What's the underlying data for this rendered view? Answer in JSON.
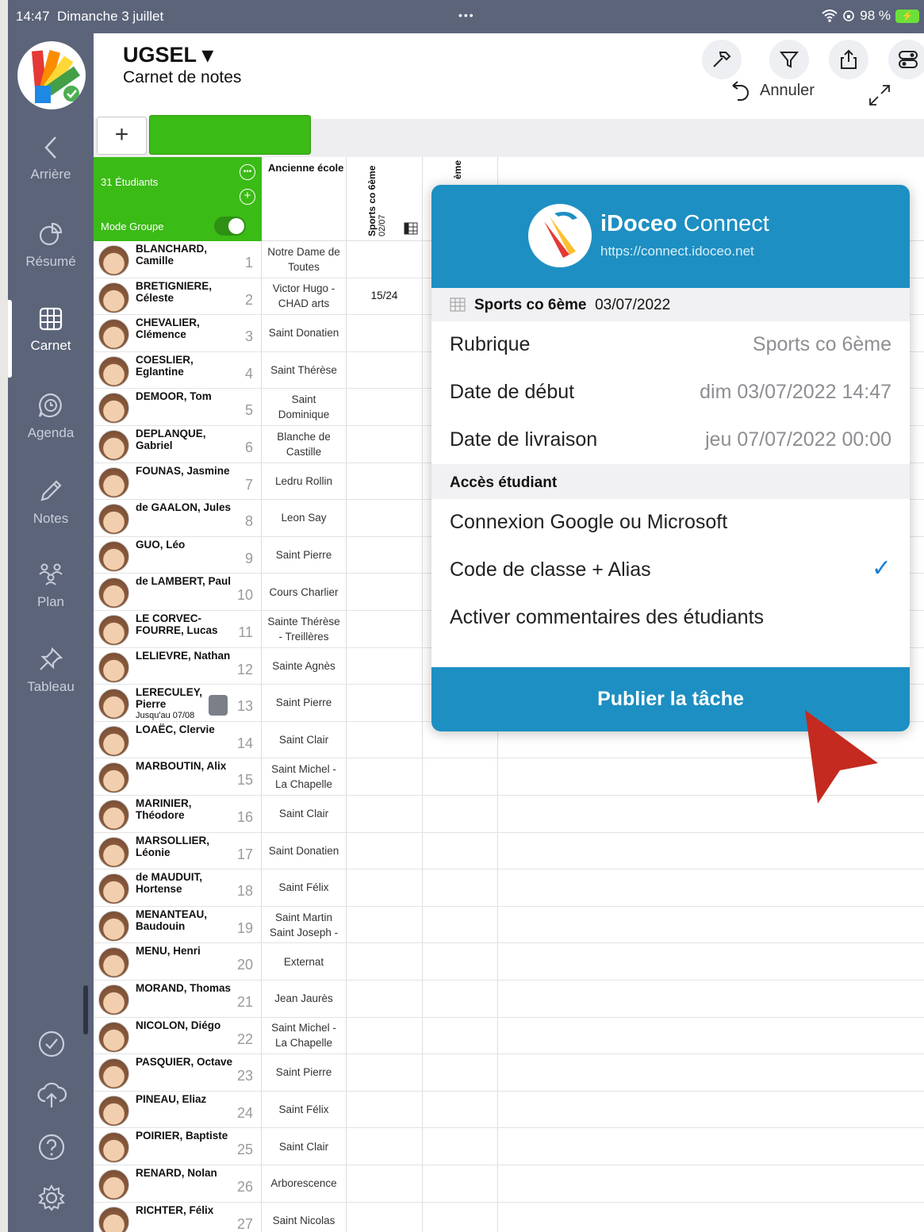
{
  "status": {
    "time": "14:47",
    "date": "Dimanche 3 juillet",
    "dots": "•••",
    "battery": "98 %"
  },
  "sidebar": {
    "items": [
      {
        "label": "Arrière"
      },
      {
        "label": "Résumé"
      },
      {
        "label": "Carnet"
      },
      {
        "label": "Agenda"
      },
      {
        "label": "Notes"
      },
      {
        "label": "Plan"
      },
      {
        "label": "Tableau"
      }
    ]
  },
  "header": {
    "title": "UGSEL ▾",
    "subtitle": "Carnet de notes",
    "undo_label": "Annuler"
  },
  "tabs": {
    "add_label": "+"
  },
  "group": {
    "count": "31 Étudiants",
    "mode": "Mode Groupe"
  },
  "columns": {
    "school": "Ancienne école",
    "task": "Sports co 6ème",
    "task_date": "02/07",
    "task2": "ème"
  },
  "students": [
    {
      "name": "BLANCHARD, Camille",
      "num": "1",
      "school": "Notre Dame de Toutes",
      "grade": ""
    },
    {
      "name": "BRETIGNIERE, Céleste",
      "num": "2",
      "school": "Victor Hugo - CHAD arts",
      "grade": "15/24"
    },
    {
      "name": "CHEVALIER, Clémence",
      "num": "3",
      "school": "Saint Donatien",
      "grade": ""
    },
    {
      "name": "COESLIER, Eglantine",
      "num": "4",
      "school": "Saint Thérèse",
      "grade": ""
    },
    {
      "name": "DEMOOR, Tom",
      "num": "5",
      "school": "Saint Dominique",
      "grade": ""
    },
    {
      "name": "DEPLANQUE, Gabriel",
      "num": "6",
      "school": "Blanche de Castille",
      "grade": ""
    },
    {
      "name": "FOUNAS, Jasmine",
      "num": "7",
      "school": "Ledru Rollin",
      "grade": ""
    },
    {
      "name": "de GAALON, Jules",
      "num": "8",
      "school": "Leon Say",
      "grade": ""
    },
    {
      "name": "GUO, Léo",
      "num": "9",
      "school": "Saint Pierre",
      "grade": ""
    },
    {
      "name": "de LAMBERT, Paul",
      "num": "10",
      "school": "Cours Charlier",
      "grade": ""
    },
    {
      "name": "LE CORVEC-FOURRE, Lucas",
      "num": "11",
      "school": "Sainte Thérèse - Treillères",
      "grade": ""
    },
    {
      "name": "LELIEVRE, Nathan",
      "num": "12",
      "school": "Sainte Agnès",
      "grade": ""
    },
    {
      "name": "LERECULEY, Pierre",
      "num": "13",
      "school": "Saint Pierre",
      "grade": "",
      "note": "Jusqu'au 07/08"
    },
    {
      "name": "LOAËC, Clervie",
      "num": "14",
      "school": "Saint Clair",
      "grade": ""
    },
    {
      "name": "MARBOUTIN, Alix",
      "num": "15",
      "school": "Saint Michel - La Chapelle",
      "grade": ""
    },
    {
      "name": "MARINIER, Théodore",
      "num": "16",
      "school": "Saint Clair",
      "grade": ""
    },
    {
      "name": "MARSOLLIER, Léonie",
      "num": "17",
      "school": "Saint Donatien",
      "grade": ""
    },
    {
      "name": "de MAUDUIT, Hortense",
      "num": "18",
      "school": "Saint Félix",
      "grade": ""
    },
    {
      "name": "MENANTEAU, Baudouin",
      "num": "19",
      "school": "Saint Martin Saint Joseph -",
      "grade": ""
    },
    {
      "name": "MENU, Henri",
      "num": "20",
      "school": "Externat",
      "grade": ""
    },
    {
      "name": "MORAND, Thomas",
      "num": "21",
      "school": "Jean Jaurès",
      "grade": ""
    },
    {
      "name": "NICOLON, Diégo",
      "num": "22",
      "school": "Saint Michel - La Chapelle",
      "grade": ""
    },
    {
      "name": "PASQUIER, Octave",
      "num": "23",
      "school": "Saint Pierre",
      "grade": ""
    },
    {
      "name": "PINEAU, Eliaz",
      "num": "24",
      "school": "Saint Félix",
      "grade": ""
    },
    {
      "name": "POIRIER, Baptiste",
      "num": "25",
      "school": "Saint Clair",
      "grade": ""
    },
    {
      "name": "RENARD, Nolan",
      "num": "26",
      "school": "Arborescence",
      "grade": ""
    },
    {
      "name": "RICHTER, Félix",
      "num": "27",
      "school": "Saint Nicolas",
      "grade": ""
    }
  ],
  "popup": {
    "brand_bold": "iDoceo",
    "brand_rest": " Connect",
    "url": "https://connect.idoceo.net",
    "task_name": "Sports co 6ème",
    "task_date": "03/07/2022",
    "rows": [
      {
        "label": "Rubrique",
        "value": "Sports co 6ème"
      },
      {
        "label": "Date de début",
        "value": "dim 03/07/2022 14:47"
      },
      {
        "label": "Date de livraison",
        "value": "jeu 07/07/2022 00:00"
      }
    ],
    "access_header": "Accès étudiant",
    "options": [
      {
        "label": "Connexion Google ou Microsoft"
      },
      {
        "label": "Code de classe + Alias",
        "checked": "✓"
      },
      {
        "label": "Activer commentaires des étudiants"
      }
    ],
    "publish": "Publier la tâche"
  },
  "colors": {
    "sidebar": "#5b6479",
    "green": "#3bbb16",
    "blue": "#1d8fc2",
    "arrow": "#c42a1f"
  }
}
